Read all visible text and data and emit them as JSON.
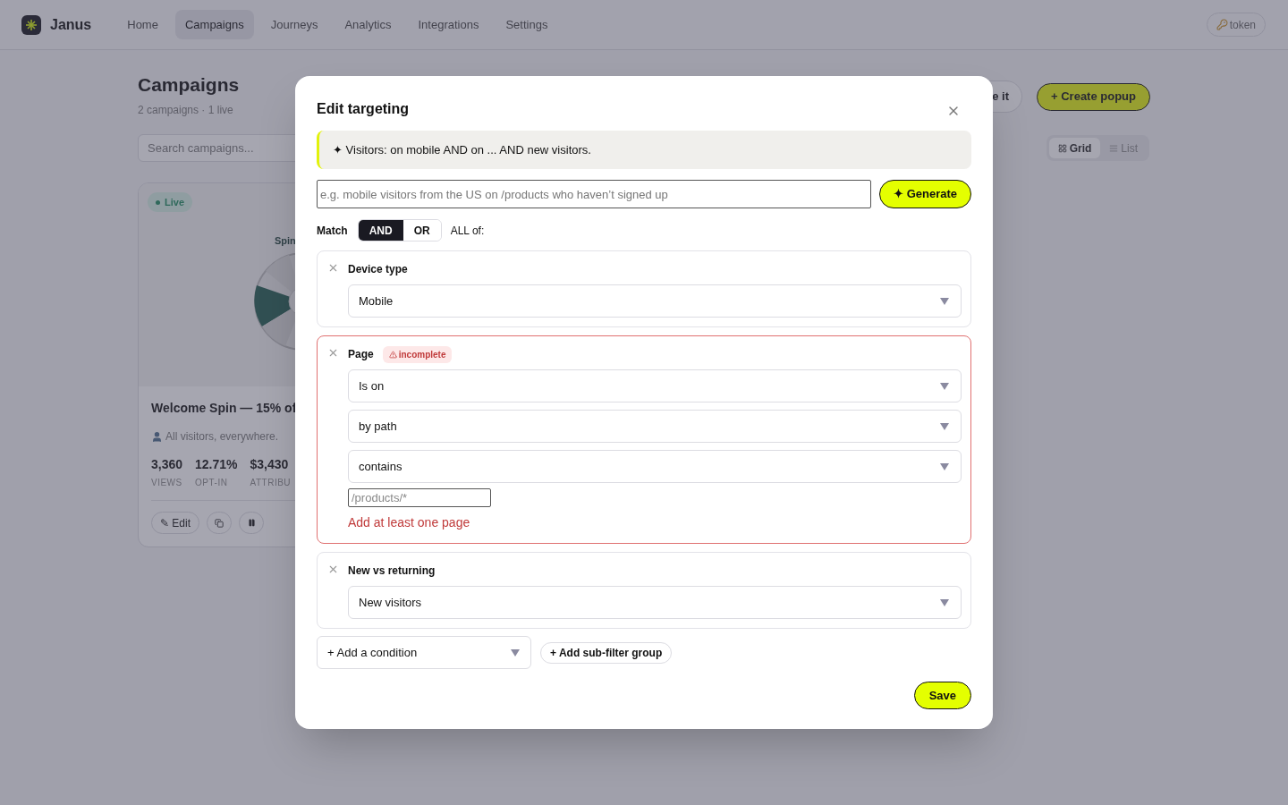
{
  "nav": {
    "brand": "Janus",
    "items": [
      {
        "label": "Home",
        "selected": false
      },
      {
        "label": "Campaigns",
        "selected": true
      },
      {
        "label": "Journeys",
        "selected": false
      },
      {
        "label": "Analytics",
        "selected": false
      },
      {
        "label": "Integrations",
        "selected": false
      },
      {
        "label": "Settings",
        "selected": false
      }
    ],
    "token_button": "token"
  },
  "page": {
    "title": "Campaigns",
    "subtitle": "2 campaigns · 1 live",
    "partial_button": "e it",
    "create_button": "+ Create popup",
    "search": {
      "placeholder": "Search campaigns..."
    },
    "view_toggle": [
      {
        "label": "Grid",
        "selected": true,
        "kind": "grid"
      },
      {
        "label": "List",
        "selected": false,
        "kind": "list"
      }
    ]
  },
  "card": {
    "status": "Live",
    "preview_title": "Spin",
    "title": "Welcome Spin — 15% of",
    "audience": "All visitors, everywhere.",
    "stats": [
      {
        "value": "3,360",
        "label": "VIEWS"
      },
      {
        "value": "12.71%",
        "label": "OPT-IN"
      },
      {
        "value": "$3,430",
        "label": "ATTRIBU"
      }
    ],
    "actions": [
      {
        "kind": "edit",
        "label": "✎ Edit"
      },
      {
        "kind": "duplicate"
      },
      {
        "kind": "pause"
      }
    ]
  },
  "modal": {
    "title": "Edit targeting",
    "summary": "✦ Visitors: on mobile AND on ... AND new visitors.",
    "prompt": {
      "placeholder": "e.g. mobile visitors from the US on /products who haven’t signed up"
    },
    "generate_button": "✦ Generate",
    "match": {
      "label": "Match",
      "options": [
        {
          "label": "AND",
          "selected": true
        },
        {
          "label": "OR",
          "selected": false
        }
      ],
      "suffix": "ALL of:"
    },
    "conditions": [
      {
        "title": "Device type",
        "incomplete": false,
        "selects": [
          "Mobile"
        ]
      },
      {
        "title": "Page",
        "incomplete": true,
        "badge": "incomplete",
        "selects": [
          "Is on",
          "by path",
          "contains"
        ],
        "path_input": {
          "placeholder": "/products/*"
        },
        "error": "Add at least one page"
      },
      {
        "title": "New vs returning",
        "incomplete": false,
        "selects": [
          "New visitors"
        ]
      }
    ],
    "add_condition": "+ Add a condition",
    "add_group": "+ Add sub-filter group",
    "save_button": "Save"
  }
}
